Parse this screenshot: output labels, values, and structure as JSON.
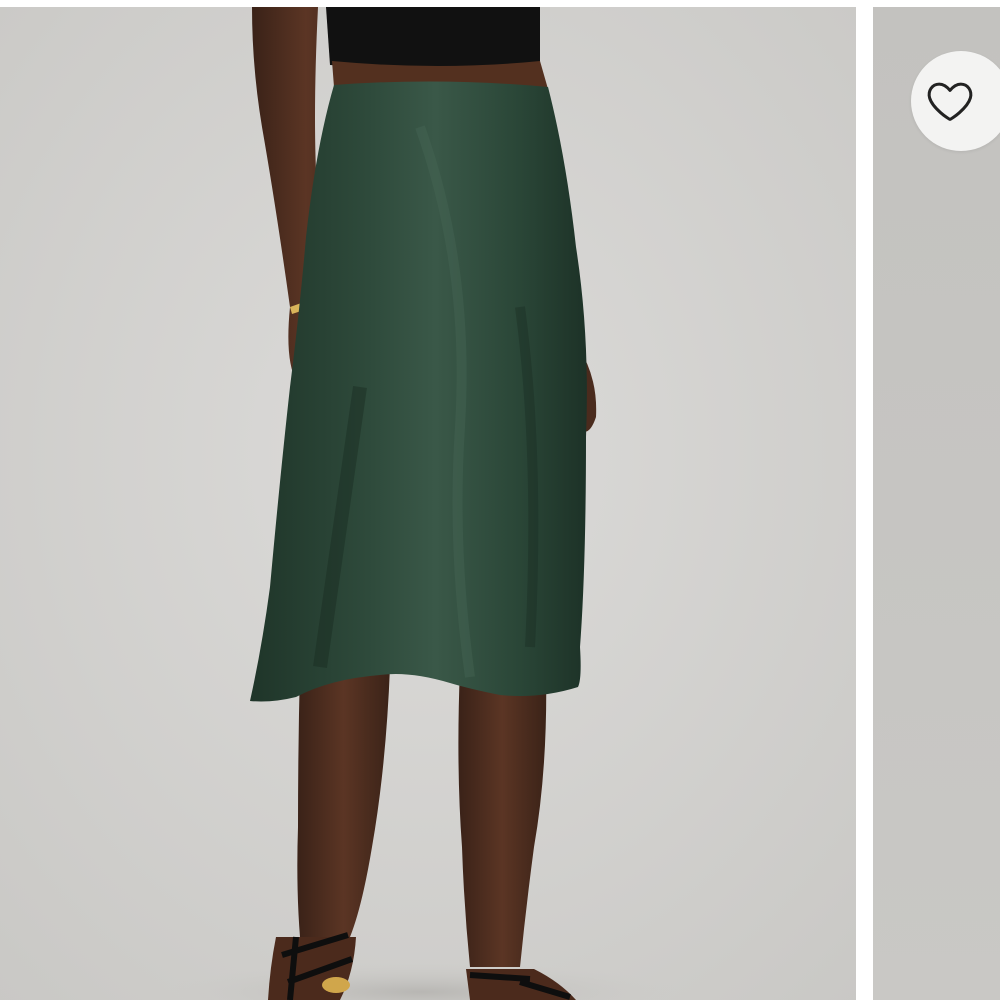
{
  "product_gallery": {
    "main_image": {
      "subject": "model-wearing-skirt",
      "skirt_color": "#2a4637",
      "background_color": "#d4d3d1"
    },
    "next_image": {
      "background_color": "#c6c5c2"
    }
  },
  "wishlist_button": {
    "icon": "heart-outline-icon",
    "icon_color": "#222222",
    "background_color": "#f3f3f2"
  }
}
